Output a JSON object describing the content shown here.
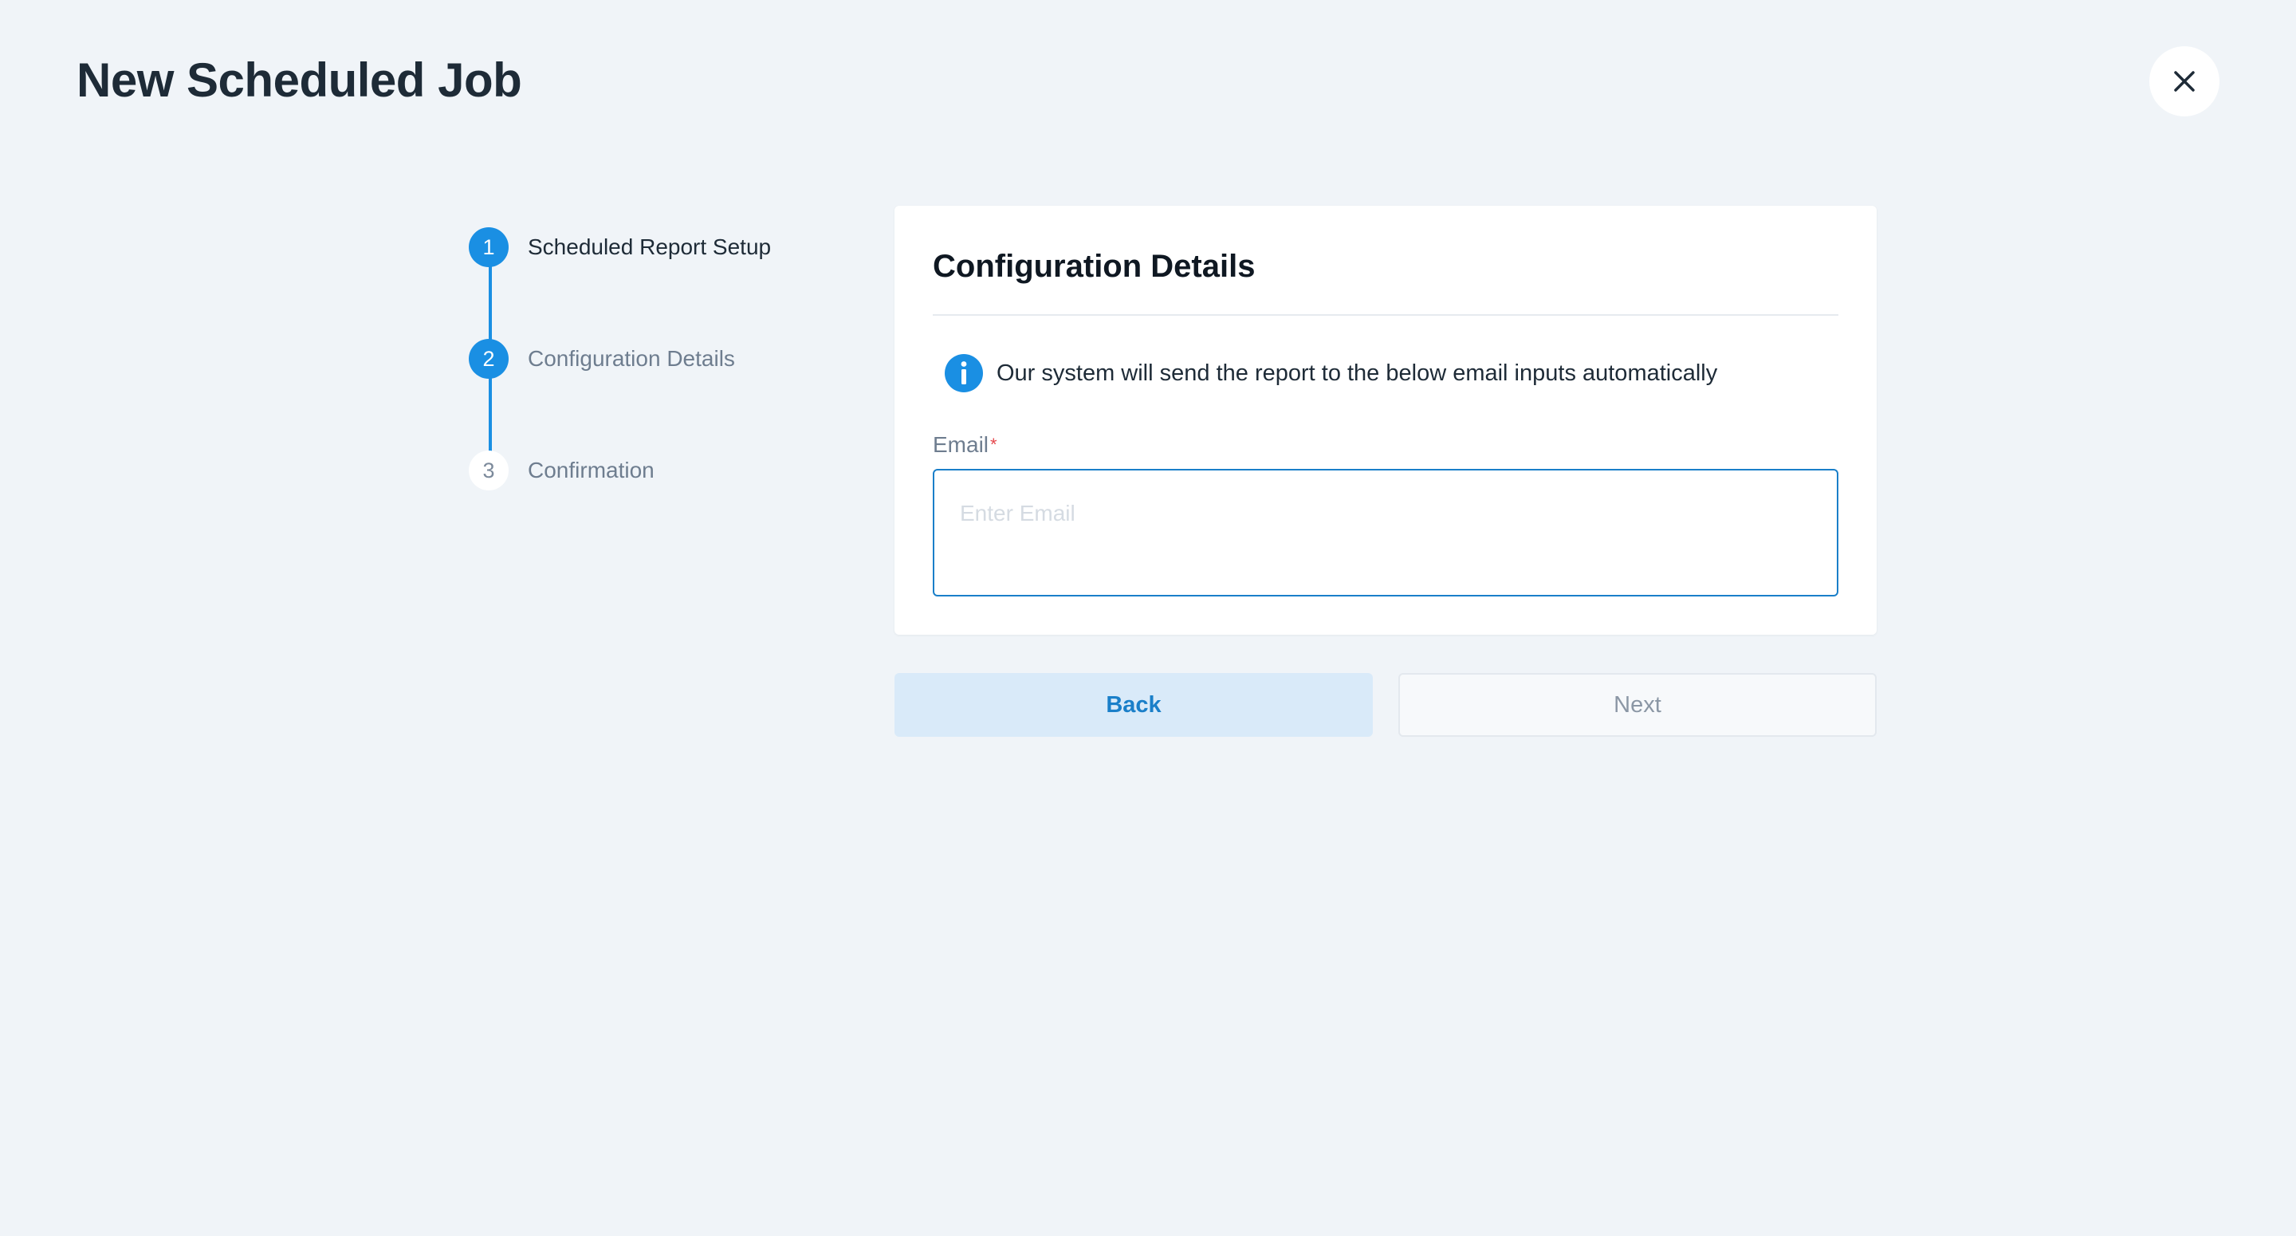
{
  "page": {
    "title": "New Scheduled Job"
  },
  "header": {
    "close_icon": "close-icon"
  },
  "stepper": {
    "steps": [
      {
        "number": "1",
        "label": "Scheduled Report Setup",
        "state": "completed"
      },
      {
        "number": "2",
        "label": "Configuration Details",
        "state": "current"
      },
      {
        "number": "3",
        "label": "Confirmation",
        "state": "pending"
      }
    ]
  },
  "card": {
    "title": "Configuration Details",
    "info_icon": "info-icon",
    "info_text": "Our system will send the report to the below email inputs automatically",
    "email": {
      "label": "Email",
      "required_mark": "*",
      "placeholder": "Enter Email",
      "value": ""
    }
  },
  "actions": {
    "back_label": "Back",
    "next_label": "Next"
  },
  "colors": {
    "accent": "#1a8fe3",
    "background": "#f0f4f8",
    "required": "#e5484d"
  }
}
